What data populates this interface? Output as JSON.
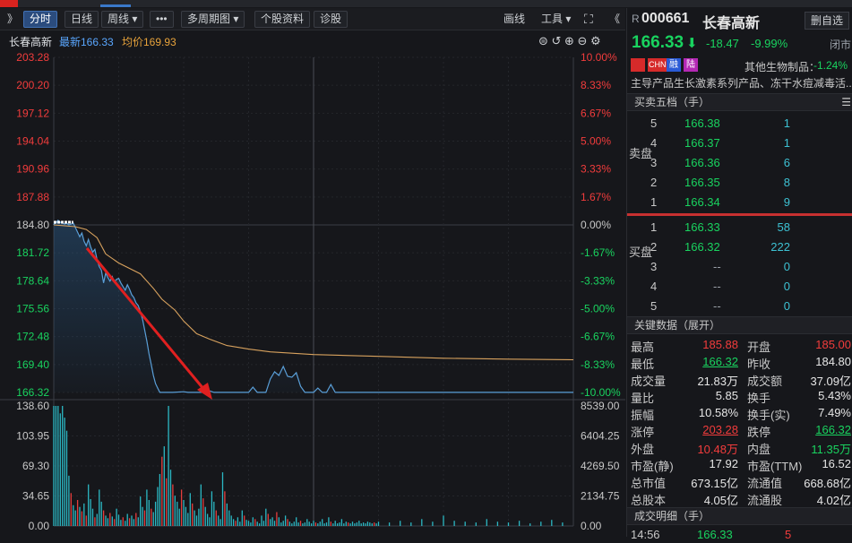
{
  "toolbar": {
    "expand": "》",
    "tabs": [
      {
        "label": "分时"
      },
      {
        "label": "日线"
      },
      {
        "label": "周线 ▾"
      },
      {
        "label": "•••"
      },
      {
        "label": "多周期图 ▾"
      },
      {
        "label": "个股资料"
      },
      {
        "label": "诊股"
      }
    ],
    "draw": "画线",
    "tools": "工具 ▾",
    "fullscreen": "⛶",
    "collapse": "《"
  },
  "info": {
    "name": "长春高新",
    "latest": "最新166.33",
    "avg": "均价169.93"
  },
  "chart_data": {
    "type": "line",
    "price_axis": [
      "203.28",
      "200.20",
      "197.12",
      "194.04",
      "190.96",
      "187.88",
      "184.80",
      "181.72",
      "178.64",
      "175.56",
      "172.48",
      "169.40",
      "166.32"
    ],
    "pct_axis": [
      "10.00%",
      "8.33%",
      "6.67%",
      "5.00%",
      "3.33%",
      "1.67%",
      "0.00%",
      "-1.67%",
      "-3.33%",
      "-5.00%",
      "-6.67%",
      "-8.33%",
      "-10.00%"
    ],
    "vol_axis_left": [
      "138.60",
      "103.95",
      "69.30",
      "34.65",
      "0.00"
    ],
    "vol_axis_right": [
      "8539.00",
      "6404.25",
      "4269.50",
      "2134.75",
      "0.00"
    ],
    "prev_close": 184.8,
    "ylim": [
      166.32,
      203.28
    ],
    "price_series": [
      [
        0,
        184.9
      ],
      [
        1,
        185.0
      ],
      [
        2,
        185.3
      ],
      [
        3,
        185.1
      ],
      [
        4,
        185.0
      ],
      [
        5,
        184.9
      ],
      [
        6,
        185.0
      ],
      [
        7,
        184.8
      ],
      [
        8,
        184.9
      ],
      [
        9,
        185.0
      ],
      [
        10,
        184.5
      ],
      [
        11,
        184.0
      ],
      [
        12,
        183.5
      ],
      [
        13,
        183.9
      ],
      [
        14,
        183.0
      ],
      [
        15,
        182.5
      ],
      [
        16,
        183.2
      ],
      [
        17,
        182.4
      ],
      [
        18,
        181.8
      ],
      [
        19,
        182.1
      ],
      [
        20,
        181.0
      ],
      [
        21,
        180.2
      ],
      [
        22,
        179.8
      ],
      [
        23,
        178.4
      ],
      [
        24,
        179.5
      ],
      [
        25,
        179.0
      ],
      [
        26,
        178.6
      ],
      [
        27,
        179.1
      ],
      [
        28,
        178.5
      ],
      [
        29,
        178.8
      ],
      [
        30,
        178.9
      ],
      [
        31,
        178.4
      ],
      [
        32,
        178.0
      ],
      [
        33,
        177.6
      ],
      [
        34,
        178.2
      ],
      [
        35,
        177.7
      ],
      [
        36,
        177.1
      ],
      [
        37,
        176.8
      ],
      [
        38,
        176.2
      ],
      [
        39,
        175.9
      ],
      [
        40,
        175.2
      ],
      [
        41,
        174.4
      ],
      [
        42,
        173.2
      ],
      [
        43,
        172.0
      ],
      [
        44,
        170.6
      ],
      [
        45,
        169.4
      ],
      [
        46,
        168.2
      ],
      [
        47,
        167.3
      ],
      [
        48,
        166.8
      ],
      [
        49,
        166.33
      ],
      [
        50,
        166.33
      ],
      [
        55,
        166.33
      ],
      [
        60,
        166.4
      ],
      [
        62,
        166.33
      ],
      [
        70,
        166.33
      ],
      [
        72,
        166.5
      ],
      [
        74,
        166.33
      ],
      [
        90,
        166.33
      ],
      [
        92,
        166.9
      ],
      [
        94,
        166.33
      ],
      [
        98,
        166.33
      ],
      [
        100,
        167.8
      ],
      [
        102,
        168.6
      ],
      [
        104,
        168.2
      ],
      [
        106,
        169.2
      ],
      [
        108,
        168.1
      ],
      [
        110,
        168.0
      ],
      [
        112,
        168.5
      ],
      [
        114,
        167.0
      ],
      [
        116,
        166.33
      ],
      [
        120,
        166.33
      ],
      [
        122,
        166.8
      ],
      [
        124,
        166.33
      ],
      [
        126,
        166.33
      ],
      [
        128,
        167.2
      ],
      [
        130,
        166.33
      ],
      [
        135,
        166.33
      ],
      [
        240,
        166.33
      ]
    ],
    "avg_series": [
      [
        0,
        184.8
      ],
      [
        10,
        184.6
      ],
      [
        15,
        184.3
      ],
      [
        20,
        183.4
      ],
      [
        24,
        181.6
      ],
      [
        30,
        180.6
      ],
      [
        40,
        179.4
      ],
      [
        46,
        177.8
      ],
      [
        50,
        176.6
      ],
      [
        56,
        175.4
      ],
      [
        60,
        174.2
      ],
      [
        66,
        172.8
      ],
      [
        72,
        172.2
      ],
      [
        80,
        171.5
      ],
      [
        90,
        171.1
      ],
      [
        100,
        170.8
      ],
      [
        120,
        170.5
      ],
      [
        150,
        170.3
      ],
      [
        180,
        170.1
      ],
      [
        210,
        170.0
      ],
      [
        240,
        169.93
      ]
    ],
    "volume_bars": [
      [
        0,
        138.6,
        "c"
      ],
      [
        1,
        138.6,
        "c"
      ],
      [
        2,
        138.6,
        "c"
      ],
      [
        3,
        130,
        "c"
      ],
      [
        4,
        138.6,
        "c"
      ],
      [
        5,
        125,
        "c"
      ],
      [
        6,
        110,
        "c"
      ],
      [
        7,
        58,
        "c"
      ],
      [
        8,
        38,
        "r"
      ],
      [
        9,
        24,
        "c"
      ],
      [
        10,
        18,
        "c"
      ],
      [
        11,
        30,
        "r"
      ],
      [
        12,
        22,
        "c"
      ],
      [
        13,
        17,
        "r"
      ],
      [
        14,
        26,
        "c"
      ],
      [
        15,
        12,
        "r"
      ],
      [
        16,
        48,
        "c"
      ],
      [
        17,
        31,
        "c"
      ],
      [
        18,
        20,
        "c"
      ],
      [
        19,
        10,
        "r"
      ],
      [
        20,
        14,
        "c"
      ],
      [
        21,
        42,
        "c"
      ],
      [
        22,
        28,
        "c"
      ],
      [
        23,
        18,
        "r"
      ],
      [
        24,
        12,
        "c"
      ],
      [
        25,
        9,
        "c"
      ],
      [
        26,
        15,
        "r"
      ],
      [
        27,
        11,
        "c"
      ],
      [
        28,
        8,
        "r"
      ],
      [
        29,
        20,
        "c"
      ],
      [
        30,
        13,
        "c"
      ],
      [
        31,
        7,
        "c"
      ],
      [
        32,
        10,
        "r"
      ],
      [
        33,
        6,
        "c"
      ],
      [
        34,
        14,
        "c"
      ],
      [
        35,
        9,
        "r"
      ],
      [
        36,
        12,
        "c"
      ],
      [
        37,
        8,
        "c"
      ],
      [
        38,
        15,
        "r"
      ],
      [
        39,
        10,
        "c"
      ],
      [
        40,
        34,
        "c"
      ],
      [
        41,
        22,
        "c"
      ],
      [
        42,
        18,
        "r"
      ],
      [
        43,
        42,
        "c"
      ],
      [
        44,
        30,
        "c"
      ],
      [
        45,
        20,
        "r"
      ],
      [
        46,
        16,
        "c"
      ],
      [
        47,
        28,
        "c"
      ],
      [
        48,
        45,
        "c"
      ],
      [
        49,
        60,
        "c"
      ],
      [
        50,
        80,
        "r"
      ],
      [
        51,
        92,
        "c"
      ],
      [
        52,
        55,
        "r"
      ],
      [
        53,
        138.6,
        "c"
      ],
      [
        54,
        65,
        "c"
      ],
      [
        55,
        48,
        "r"
      ],
      [
        56,
        35,
        "c"
      ],
      [
        57,
        28,
        "c"
      ],
      [
        58,
        20,
        "c"
      ],
      [
        59,
        42,
        "r"
      ],
      [
        60,
        30,
        "c"
      ],
      [
        61,
        22,
        "c"
      ],
      [
        62,
        15,
        "c"
      ],
      [
        63,
        38,
        "c"
      ],
      [
        64,
        26,
        "r"
      ],
      [
        65,
        18,
        "c"
      ],
      [
        66,
        12,
        "c"
      ],
      [
        67,
        20,
        "c"
      ],
      [
        68,
        48,
        "c"
      ],
      [
        69,
        32,
        "r"
      ],
      [
        70,
        22,
        "c"
      ],
      [
        71,
        14,
        "c"
      ],
      [
        72,
        10,
        "c"
      ],
      [
        73,
        40,
        "c"
      ],
      [
        74,
        28,
        "c"
      ],
      [
        75,
        18,
        "r"
      ],
      [
        76,
        12,
        "c"
      ],
      [
        77,
        8,
        "c"
      ],
      [
        78,
        62,
        "c"
      ],
      [
        79,
        40,
        "r"
      ],
      [
        80,
        26,
        "c"
      ],
      [
        81,
        18,
        "c"
      ],
      [
        82,
        12,
        "c"
      ],
      [
        83,
        8,
        "c"
      ],
      [
        84,
        6,
        "r"
      ],
      [
        85,
        10,
        "c"
      ],
      [
        86,
        5,
        "c"
      ],
      [
        87,
        18,
        "c"
      ],
      [
        88,
        12,
        "r"
      ],
      [
        89,
        7,
        "c"
      ],
      [
        90,
        6,
        "c"
      ],
      [
        91,
        4,
        "c"
      ],
      [
        92,
        10,
        "c"
      ],
      [
        93,
        8,
        "r"
      ],
      [
        94,
        5,
        "c"
      ],
      [
        95,
        3,
        "c"
      ],
      [
        96,
        12,
        "c"
      ],
      [
        97,
        6,
        "c"
      ],
      [
        98,
        20,
        "c"
      ],
      [
        99,
        14,
        "r"
      ],
      [
        100,
        8,
        "c"
      ],
      [
        101,
        10,
        "c"
      ],
      [
        102,
        6,
        "c"
      ],
      [
        103,
        16,
        "r"
      ],
      [
        104,
        10,
        "c"
      ],
      [
        105,
        4,
        "c"
      ],
      [
        106,
        6,
        "c"
      ],
      [
        107,
        12,
        "c"
      ],
      [
        108,
        8,
        "r"
      ],
      [
        109,
        5,
        "c"
      ],
      [
        110,
        3,
        "c"
      ],
      [
        111,
        5,
        "c"
      ],
      [
        112,
        10,
        "c"
      ],
      [
        113,
        4,
        "c"
      ],
      [
        114,
        6,
        "r"
      ],
      [
        115,
        3,
        "c"
      ],
      [
        116,
        4,
        "c"
      ],
      [
        117,
        8,
        "c"
      ],
      [
        118,
        5,
        "c"
      ],
      [
        119,
        3,
        "c"
      ],
      [
        120,
        6,
        "c"
      ],
      [
        121,
        4,
        "r"
      ],
      [
        122,
        3,
        "c"
      ],
      [
        123,
        5,
        "c"
      ],
      [
        124,
        8,
        "c"
      ],
      [
        125,
        3,
        "c"
      ],
      [
        126,
        4,
        "c"
      ],
      [
        127,
        10,
        "c"
      ],
      [
        128,
        5,
        "r"
      ],
      [
        129,
        3,
        "c"
      ],
      [
        130,
        6,
        "c"
      ],
      [
        131,
        3,
        "c"
      ],
      [
        132,
        4,
        "c"
      ],
      [
        133,
        8,
        "c"
      ],
      [
        134,
        3,
        "c"
      ],
      [
        135,
        5,
        "c"
      ],
      [
        136,
        4,
        "r"
      ],
      [
        137,
        3,
        "c"
      ],
      [
        138,
        5,
        "c"
      ],
      [
        139,
        3,
        "c"
      ],
      [
        140,
        4,
        "c"
      ],
      [
        141,
        6,
        "c"
      ],
      [
        142,
        3,
        "c"
      ],
      [
        143,
        4,
        "c"
      ],
      [
        144,
        3,
        "c"
      ],
      [
        145,
        5,
        "c"
      ],
      [
        146,
        4,
        "c"
      ],
      [
        147,
        3,
        "c"
      ],
      [
        148,
        4,
        "r"
      ],
      [
        149,
        3,
        "c"
      ],
      [
        150,
        5,
        "c"
      ],
      [
        155,
        4,
        "c"
      ],
      [
        160,
        6,
        "c"
      ],
      [
        165,
        4,
        "c"
      ],
      [
        170,
        8,
        "c"
      ],
      [
        175,
        5,
        "c"
      ],
      [
        180,
        12,
        "c"
      ],
      [
        185,
        6,
        "c"
      ],
      [
        190,
        5,
        "c"
      ],
      [
        195,
        4,
        "c"
      ],
      [
        200,
        8,
        "c"
      ],
      [
        205,
        5,
        "c"
      ],
      [
        210,
        4,
        "c"
      ],
      [
        215,
        6,
        "c"
      ],
      [
        220,
        3,
        "c"
      ],
      [
        225,
        5,
        "c"
      ],
      [
        230,
        7,
        "c"
      ],
      [
        235,
        4,
        "c"
      ]
    ],
    "colors": {
      "price": "#5a9fd8",
      "avg": "#d8a25e",
      "volume_up": "#e63d3d",
      "volume_down": "#2bb8c4",
      "arrow": "#e02020"
    }
  },
  "quote": {
    "prefix": "R",
    "code": "000661",
    "name": "长春高新",
    "add_btn": "删自选",
    "price": "166.33",
    "arrow": "⬇",
    "change": "-18.47",
    "pct": "-9.99%",
    "status": "闭市",
    "tags": [
      "CHN",
      "融",
      "陆"
    ],
    "sector": "其他生物制品：",
    "sector_pct": "-1.24%",
    "desc": "主导产品生长激素系列产品、冻干水痘减毒活..."
  },
  "orderbook": {
    "title": "买卖五档（手）",
    "sell_label": "卖盘",
    "buy_label": "买盘",
    "asks": [
      {
        "lvl": "5",
        "price": "166.38",
        "qty": "1"
      },
      {
        "lvl": "4",
        "price": "166.37",
        "qty": "1"
      },
      {
        "lvl": "3",
        "price": "166.36",
        "qty": "6"
      },
      {
        "lvl": "2",
        "price": "166.35",
        "qty": "8"
      },
      {
        "lvl": "1",
        "price": "166.34",
        "qty": "9"
      }
    ],
    "bids": [
      {
        "lvl": "1",
        "price": "166.33",
        "qty": "58"
      },
      {
        "lvl": "2",
        "price": "166.32",
        "qty": "222"
      },
      {
        "lvl": "3",
        "price": "--",
        "qty": "0"
      },
      {
        "lvl": "4",
        "price": "--",
        "qty": "0"
      },
      {
        "lvl": "5",
        "price": "--",
        "qty": "0"
      }
    ]
  },
  "keydata": {
    "title": "关键数据（展开）",
    "rows": [
      [
        "最高",
        "185.88",
        "开盘",
        "185.00"
      ],
      [
        "最低",
        "166.32",
        "昨收",
        "184.80"
      ],
      [
        "成交量",
        "21.83万",
        "成交额",
        "37.09亿"
      ],
      [
        "量比",
        "5.85",
        "换手",
        "5.43%"
      ],
      [
        "振幅",
        "10.58%",
        "换手(实)",
        "7.49%"
      ],
      [
        "涨停",
        "203.28",
        "跌停",
        "166.32"
      ],
      [
        "外盘",
        "10.48万",
        "内盘",
        "11.35万"
      ],
      [
        "市盈(静)",
        "17.92",
        "市盈(TTM)",
        "16.52"
      ],
      [
        "总市值",
        "673.15亿",
        "流通值",
        "668.68亿"
      ],
      [
        "总股本",
        "4.05亿",
        "流通股",
        "4.02亿"
      ]
    ]
  },
  "trades": {
    "title": "成交明细（手）",
    "first": {
      "time": "14:56",
      "price": "166.33",
      "qty": "5"
    }
  }
}
